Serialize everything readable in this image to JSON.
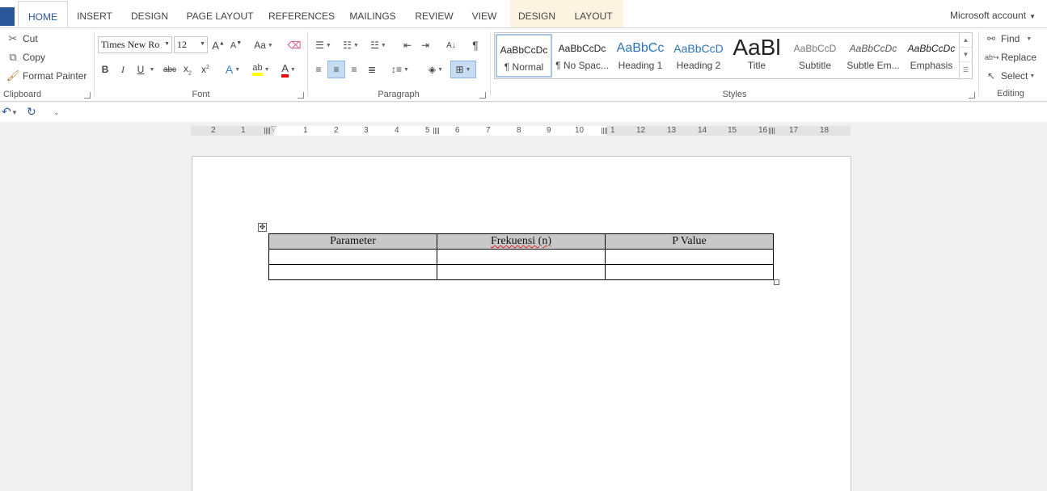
{
  "tabs": [
    "HOME",
    "INSERT",
    "DESIGN",
    "PAGE LAYOUT",
    "REFERENCES",
    "MAILINGS",
    "REVIEW",
    "VIEW",
    "DESIGN",
    "LAYOUT"
  ],
  "account": "Microsoft account",
  "clipboard": {
    "cut": "Cut",
    "copy": "Copy",
    "format_painter": "Format Painter",
    "label": "Clipboard"
  },
  "font": {
    "name": "Times New Ro",
    "size": "12",
    "label": "Font",
    "change_case": "Aa"
  },
  "paragraph": {
    "label": "Paragraph"
  },
  "styles": {
    "label": "Styles",
    "items": [
      {
        "preview": "AaBbCcDc",
        "name": "¶ Normal"
      },
      {
        "preview": "AaBbCcDc",
        "name": "¶ No Spac..."
      },
      {
        "preview": "AaBbCc",
        "name": "Heading 1"
      },
      {
        "preview": "AaBbCcD",
        "name": "Heading 2"
      },
      {
        "preview": "AaBl",
        "name": "Title"
      },
      {
        "preview": "AaBbCcD",
        "name": "Subtitle"
      },
      {
        "preview": "AaBbCcDc",
        "name": "Subtle Em..."
      },
      {
        "preview": "AaBbCcDc",
        "name": "Emphasis"
      }
    ]
  },
  "editing": {
    "find": "Find",
    "replace": "Replace",
    "select": "Select",
    "label": "Editing"
  },
  "ruler": {
    "numbers": [
      "2",
      "1",
      "1",
      "2",
      "3",
      "4",
      "5",
      "6",
      "7",
      "8",
      "9",
      "10",
      "1",
      "12",
      "13",
      "14",
      "15",
      "16",
      "17",
      "18"
    ]
  },
  "table": {
    "headers": [
      "Parameter",
      "Frekuensi (n)",
      "P Value"
    ],
    "rows": [
      [
        "",
        "",
        ""
      ],
      [
        "",
        "",
        ""
      ]
    ]
  },
  "colors": {
    "accent": "#2b579a",
    "header_fill": "#c8c8c8"
  }
}
